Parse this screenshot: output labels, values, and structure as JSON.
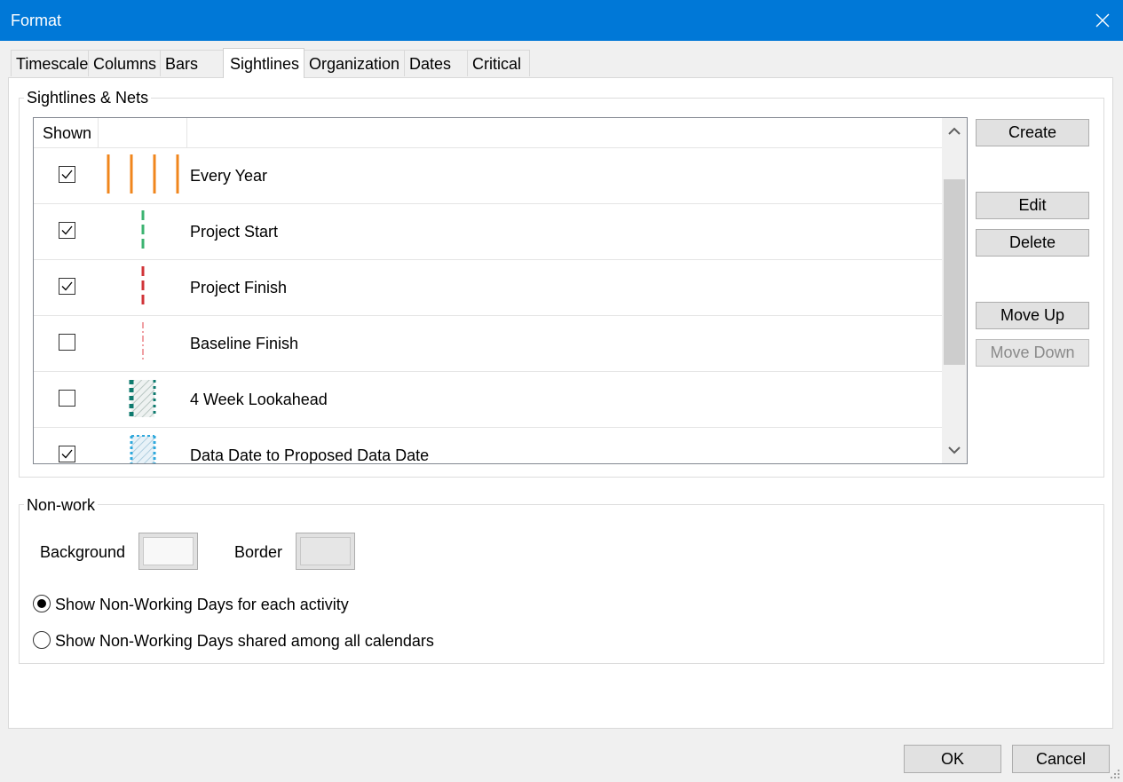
{
  "window": {
    "title": "Format"
  },
  "tabs": [
    {
      "label": "Timescale"
    },
    {
      "label": "Columns"
    },
    {
      "label": "Bars"
    },
    {
      "label": "Sightlines",
      "active": true
    },
    {
      "label": "Organization"
    },
    {
      "label": "Dates"
    },
    {
      "label": "Critical"
    }
  ],
  "sightlines": {
    "group_label": "Sightlines & Nets",
    "column_header": "Shown",
    "rows": [
      {
        "label": "Every Year",
        "shown": true,
        "color": "#f0861c"
      },
      {
        "label": "Project Start",
        "shown": true,
        "color": "#3cb371"
      },
      {
        "label": "Project Finish",
        "shown": true,
        "color": "#d13438"
      },
      {
        "label": "Baseline Finish",
        "shown": false,
        "color": "#f0a0a4"
      },
      {
        "label": "4 Week Lookahead",
        "shown": false,
        "color": "#0e7a6e"
      },
      {
        "label": "Data Date to Proposed Data Date",
        "shown": true,
        "color": "#2ea8dc"
      }
    ],
    "buttons": {
      "create": "Create",
      "edit": "Edit",
      "delete": "Delete",
      "move_up": "Move Up",
      "move_down": "Move Down"
    }
  },
  "nonwork": {
    "group_label": "Non-work",
    "background_label": "Background",
    "border_label": "Border",
    "background_color": "#f8f8f8",
    "border_color": "#e6e6e6",
    "options": [
      {
        "label": "Show Non-Working Days for each activity",
        "selected": true
      },
      {
        "label": "Show Non-Working Days shared among all calendars",
        "selected": false
      }
    ]
  },
  "footer": {
    "ok": "OK",
    "cancel": "Cancel"
  },
  "colors": {
    "titlebar": "#0078d7",
    "accent": "#0078d7"
  }
}
